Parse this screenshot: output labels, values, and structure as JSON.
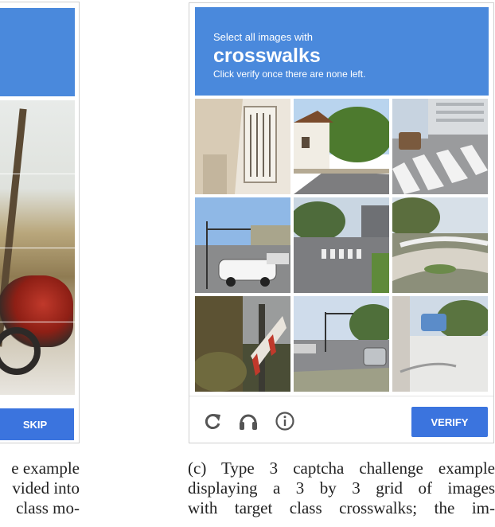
{
  "left_captcha": {
    "skip_label": "SKIP",
    "caption_lines": [
      "e example",
      "vided into",
      "class mo-",
      ""
    ]
  },
  "captcha": {
    "header": {
      "instruction": "Select all images with",
      "target": "crosswalks",
      "subtext": "Click verify once there are none left."
    },
    "tiles": [
      {
        "name": "building-window"
      },
      {
        "name": "house-trees-street"
      },
      {
        "name": "crosswalk-car"
      },
      {
        "name": "parking-lot-cars"
      },
      {
        "name": "road-crosswalk"
      },
      {
        "name": "curved-path"
      },
      {
        "name": "tree-fence"
      },
      {
        "name": "road-cars"
      },
      {
        "name": "parked-car-wall"
      }
    ],
    "icons": [
      "reload-icon",
      "audio-icon",
      "info-icon"
    ],
    "verify_label": "VERIFY",
    "header_color": "#4a89dc",
    "button_color": "#3b74de"
  },
  "caption_lines": [
    "(c) Type 3 captcha challenge example",
    "displaying a 3 by 3 grid of images",
    "with target class crosswalks; the im-",
    ""
  ]
}
